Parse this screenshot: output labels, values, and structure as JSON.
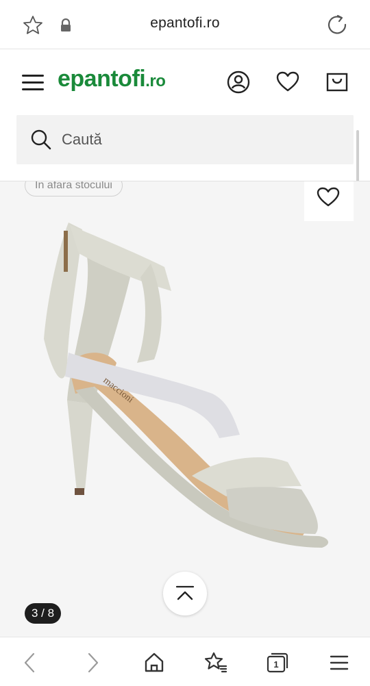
{
  "browser": {
    "url": "epantofi.ro",
    "icons": [
      "star-icon",
      "lock-icon",
      "reload-icon"
    ]
  },
  "header": {
    "logo_main": "epantofi",
    "logo_suffix": ".ro",
    "icons": [
      "menu-icon",
      "account-icon",
      "heart-icon",
      "cart-icon"
    ],
    "brand_color": "#1a8a3a"
  },
  "search": {
    "placeholder": "Caută"
  },
  "product": {
    "stock_badge": "În afara stocului",
    "image_counter": "3 / 8",
    "image_alt": "sandal-image",
    "brand_print": "maccioni"
  },
  "bottom_nav": {
    "tab_count": "1",
    "icons": [
      "back-icon",
      "forward-icon",
      "home-icon",
      "favorites-icon",
      "tabs-icon",
      "menu-icon"
    ]
  }
}
